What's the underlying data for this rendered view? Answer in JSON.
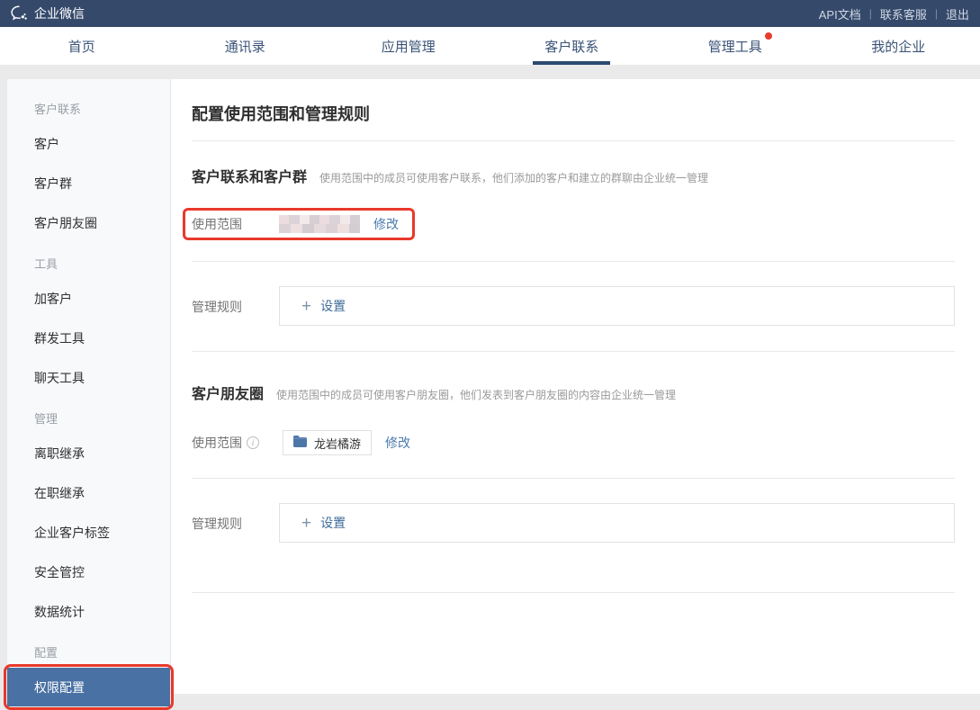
{
  "topbar": {
    "logo": "企业微信",
    "separator": "|",
    "links": [
      "API文档",
      "联系客服",
      "退出"
    ]
  },
  "nav": {
    "tabs": [
      {
        "label": "首页",
        "active": false
      },
      {
        "label": "通讯录",
        "active": false
      },
      {
        "label": "应用管理",
        "active": false
      },
      {
        "label": "客户联系",
        "active": true
      },
      {
        "label": "管理工具",
        "active": false,
        "badge": "red-dot"
      },
      {
        "label": "我的企业",
        "active": false
      }
    ]
  },
  "sidebar": {
    "groups": [
      {
        "header": "客户联系",
        "items": [
          "客户",
          "客户群",
          "客户朋友圈"
        ]
      },
      {
        "header": "工具",
        "items": [
          "加客户",
          "群发工具",
          "聊天工具"
        ]
      },
      {
        "header": "管理",
        "items": [
          "离职继承",
          "在职继承",
          "企业客户标签",
          "安全管控",
          "数据统计"
        ]
      },
      {
        "header": "配置",
        "items": [
          "权限配置"
        ]
      }
    ],
    "selected_item": "权限配置"
  },
  "main": {
    "title": "配置使用范围和管理规则",
    "section1": {
      "title": "客户联系和客户群",
      "desc": "使用范围中的成员可使用客户联系，他们添加的客户和建立的群聊由企业统一管理",
      "scope_label": "使用范围",
      "scope_value_redacted": true,
      "modify_label": "修改",
      "rules_label": "管理规则",
      "setup_label": "设置"
    },
    "section2": {
      "title": "客户朋友圈",
      "desc": "使用范围中的成员可使用客户朋友圈，他们发表到客户朋友圈的内容由企业统一管理",
      "scope_label": "使用范围",
      "scope_tag": "龙岩橘游",
      "modify_label": "修改",
      "rules_label": "管理规则",
      "setup_label": "设置"
    }
  },
  "colors": {
    "topbar_bg": "#35496b",
    "nav_text": "#3a5377",
    "active_tab_underline": "#2b4a6f",
    "selected_sidebar_bg": "#4a71a3",
    "link_blue": "#4a7aad",
    "annotation_red": "#e8392b",
    "badge_red": "#e63c2e",
    "sidebar_bg": "#f8f9fb",
    "page_bg": "#eaeaea"
  }
}
